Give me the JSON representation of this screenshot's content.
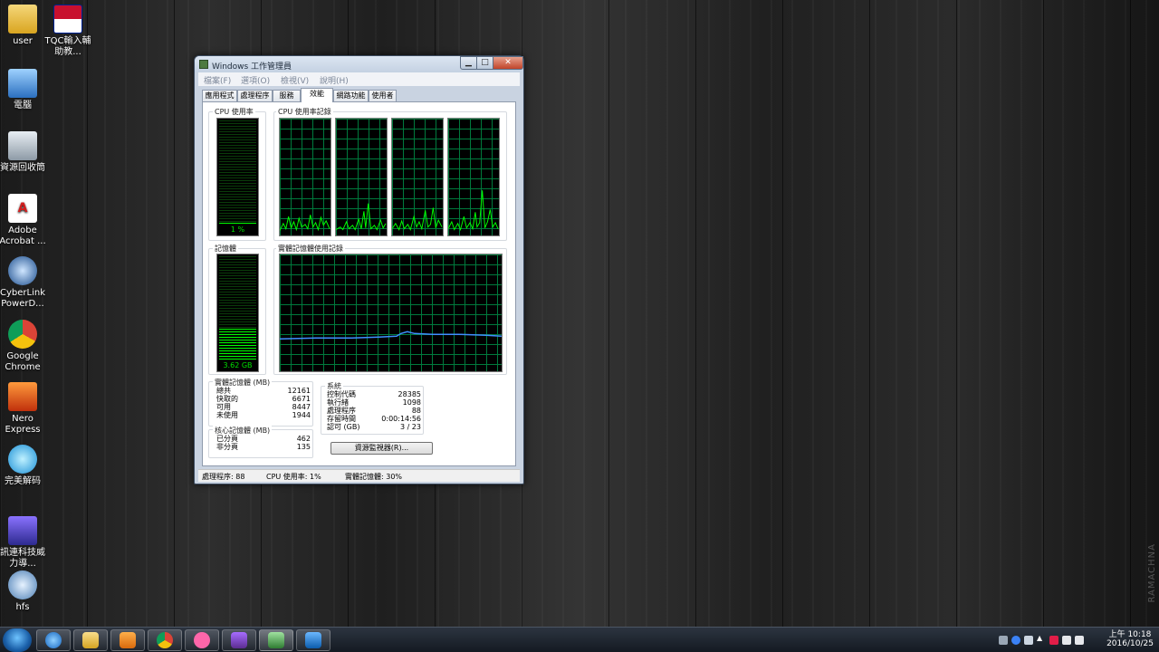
{
  "desktop": {
    "icons": [
      {
        "label": "user"
      },
      {
        "label": "TQC輸入輔助教..."
      },
      {
        "label": "電腦"
      },
      {
        "label": "資源回收筒"
      },
      {
        "label": "Adobe Acrobat ..."
      },
      {
        "label": "CyberLink PowerD..."
      },
      {
        "label": "Google Chrome"
      },
      {
        "label": "Nero Express"
      },
      {
        "label": "完美解码"
      },
      {
        "label": "訊連科技威力導..."
      },
      {
        "label": "hfs"
      }
    ],
    "watermark": "RAMACHNA"
  },
  "window": {
    "title": "Windows 工作管理員",
    "min": "▁",
    "max": "□",
    "close": "✕",
    "menu": [
      "檔案(F)",
      "選項(O)",
      "檢視(V)",
      "說明(H)"
    ],
    "tabs": [
      "應用程式",
      "處理程序",
      "服務",
      "效能",
      "網路功能",
      "使用者"
    ],
    "active_tab": "效能",
    "cpu": {
      "title": "CPU 使用率",
      "value": "1 %",
      "history_title": "CPU 使用率記錄",
      "usage_fraction": 0.01
    },
    "memory": {
      "title": "記憶體",
      "value": "3.62 GB",
      "history_title": "實體記憶體使用記錄",
      "usage_fraction": 0.3
    },
    "physical": {
      "title": "實體記憶體 (MB)",
      "rows": [
        {
          "k": "總共",
          "v": "12161"
        },
        {
          "k": "快取的",
          "v": "6671"
        },
        {
          "k": "可用",
          "v": "8447"
        },
        {
          "k": "未使用",
          "v": "1944"
        }
      ]
    },
    "kernel": {
      "title": "核心記憶體 (MB)",
      "rows": [
        {
          "k": "已分頁",
          "v": "462"
        },
        {
          "k": "非分頁",
          "v": "135"
        }
      ]
    },
    "system": {
      "title": "系統",
      "rows": [
        {
          "k": "控制代碼",
          "v": "28385"
        },
        {
          "k": "執行緒",
          "v": "1098"
        },
        {
          "k": "處理程序",
          "v": "88"
        },
        {
          "k": "存留時間",
          "v": "0:00:14:56"
        },
        {
          "k": "認可 (GB)",
          "v": "3 / 23"
        }
      ]
    },
    "resource_button": "資源監視器(R)...",
    "status": {
      "processes": "處理程序: 88",
      "cpu": "CPU 使用率: 1%",
      "memory": "實體記憶體: 30%"
    }
  },
  "taskbar": {
    "clock_time": "上午 10:18",
    "clock_date": "2016/10/25",
    "apps": [
      "internet-explorer",
      "file-explorer",
      "media-player",
      "chrome",
      "osu",
      "visual-studio",
      "task-manager",
      "teamviewer"
    ]
  }
}
